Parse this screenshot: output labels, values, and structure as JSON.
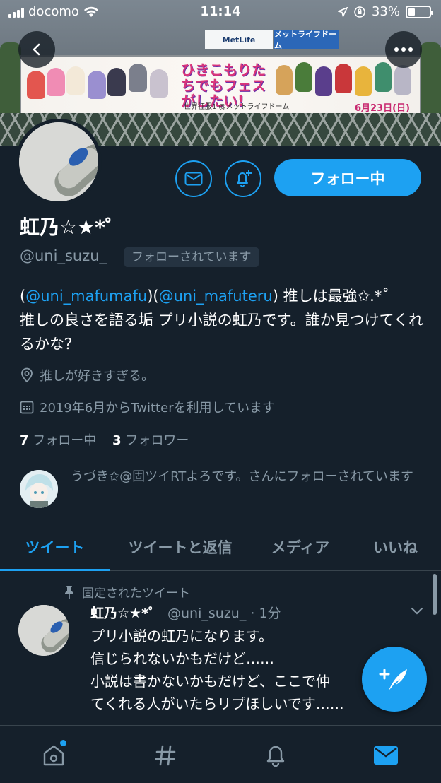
{
  "status_bar": {
    "carrier": "docomo",
    "time": "11:14",
    "battery_percent": "33%",
    "battery_level": 0.33
  },
  "banner": {
    "sign_left": "MetLife",
    "sign_right": "メットライフドーム",
    "billboard_title": "ひきこもりたちでもフェスがしたい!",
    "billboard_sub": "世界征服1 @メットライフドーム",
    "billboard_date": "6月23日(日)"
  },
  "header_icons": {
    "back": "chevron-left-icon",
    "more": "more-icon"
  },
  "actions": {
    "message": "mail-icon",
    "notify": "bell-plus-icon",
    "follow_label": "フォロー中"
  },
  "profile": {
    "name": "虹乃☆★*゜",
    "handle": "@uni_suzu_",
    "follows_you": "フォローされています",
    "bio": {
      "mention1": "@uni_mafumafu",
      "mention2": "@uni_mafuteru",
      "after_mentions": " 推しは最強✩.*˚",
      "line2": "推しの良さを語る垢 プリ小説の虹乃です。誰か見つけてくれるかな？"
    },
    "location": "推しが好きすぎる。",
    "joined": "2019年6月からTwitterを利用しています",
    "following_count": "7",
    "following_label": "フォロー中",
    "followers_count": "3",
    "followers_label": "フォロワー",
    "followed_by": "うづき✩@固ツイRTよろです。さんにフォローされています"
  },
  "tabs": [
    {
      "label": "ツイート",
      "active": true
    },
    {
      "label": "ツイートと返信",
      "active": false
    },
    {
      "label": "メディア",
      "active": false
    },
    {
      "label": "いいね",
      "active": false
    }
  ],
  "pinned_tweet": {
    "pinned_label": "固定されたツイート",
    "name": "虹乃☆★*゜",
    "handle_time": "@uni_suzu_ · 1分",
    "body": "プリ小説の虹乃になります。\n信じられないかもだけど……\n小説は書かないかもだけど、ここで仲\nてくれる人がいたらリプほしいです……"
  },
  "colors": {
    "background": "#15202b",
    "accent": "#1da1f2",
    "secondary_text": "#8899a6",
    "divider": "#38444d"
  },
  "bottom_nav": [
    "home-icon",
    "explore-hash-icon",
    "notifications-bell-icon",
    "messages-envelope-icon"
  ]
}
